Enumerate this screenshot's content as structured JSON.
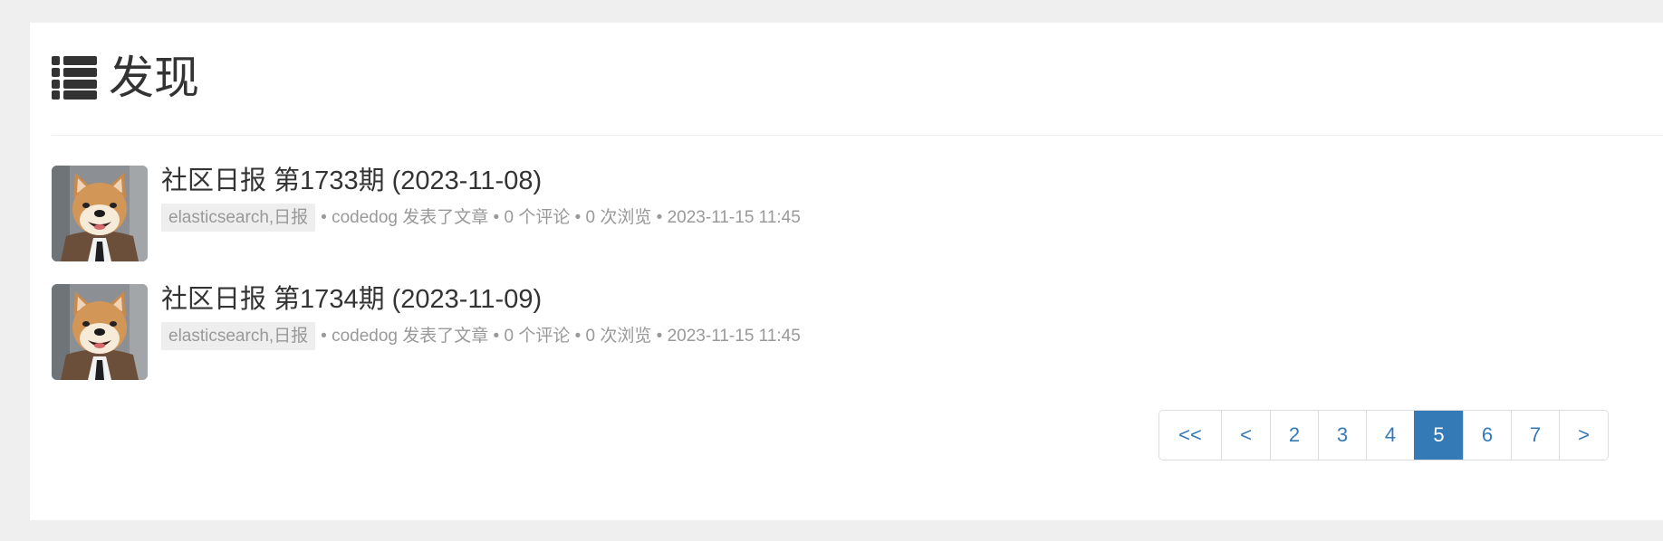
{
  "page": {
    "title": "发现",
    "title_icon": "list-icon"
  },
  "articles": [
    {
      "title": "社区日报 第1733期 (2023-11-08)",
      "tag": "elasticsearch,日报",
      "meta": "• codedog 发表了文章 • 0 个评论 • 0 次浏览 • 2023-11-15 11:45",
      "avatar": "shiba-dog-avatar"
    },
    {
      "title": "社区日报 第1734期 (2023-11-09)",
      "tag": "elasticsearch,日报",
      "meta": "• codedog 发表了文章 • 0 个评论 • 0 次浏览 • 2023-11-15 11:45",
      "avatar": "shiba-dog-avatar"
    }
  ],
  "pagination": {
    "first": "<<",
    "prev": "<",
    "pages": [
      "2",
      "3",
      "4",
      "5",
      "6",
      "7"
    ],
    "current": "5",
    "next": ">"
  },
  "colors": {
    "accent": "#337ab7",
    "background": "#efefef",
    "panel": "#ffffff"
  }
}
